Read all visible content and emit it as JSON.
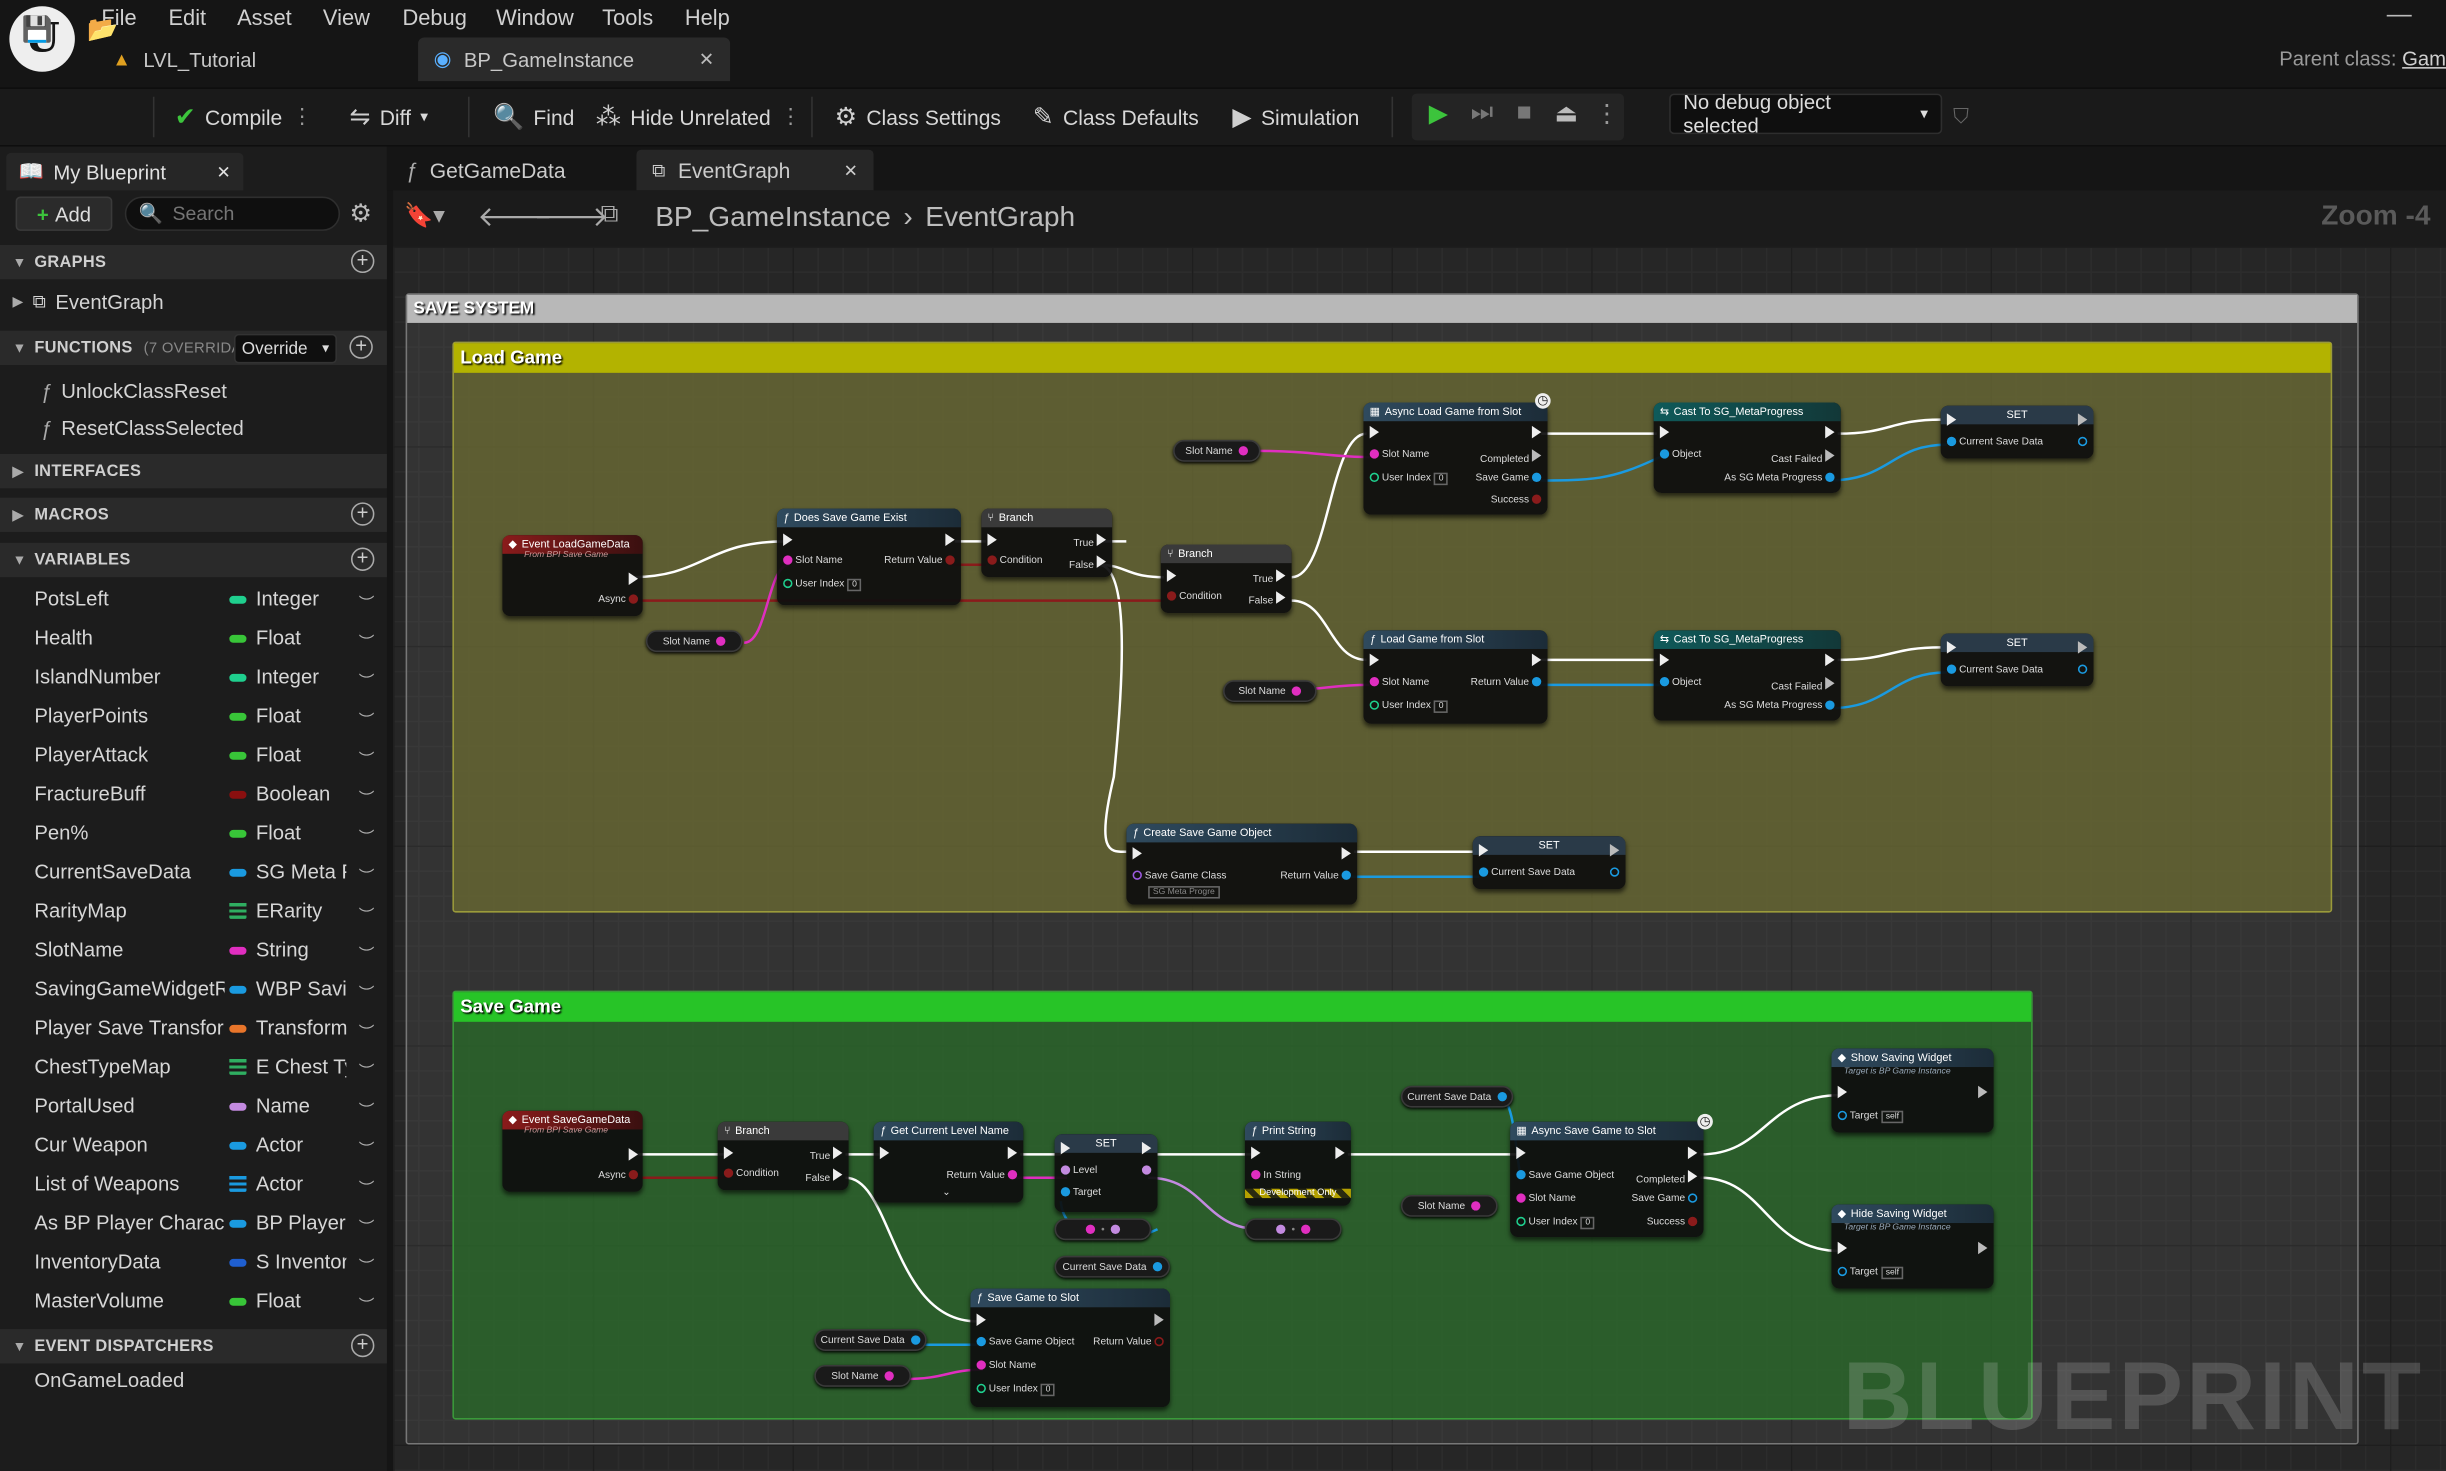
{
  "menu": [
    "File",
    "Edit",
    "Asset",
    "View",
    "Debug",
    "Window",
    "Tools",
    "Help"
  ],
  "window_tabs": [
    {
      "label": "LVL_Tutorial"
    },
    {
      "label": "BP_GameInstance"
    }
  ],
  "parent_class": {
    "label": "Parent class:",
    "value": "Gam"
  },
  "toolbar": {
    "compile": "Compile",
    "diff": "Diff",
    "find": "Find",
    "hide_unrelated": "Hide Unrelated",
    "class_settings": "Class Settings",
    "class_defaults": "Class Defaults",
    "simulation": "Simulation",
    "debug_object": "No debug object selected"
  },
  "colors": {
    "accent_green": "#3ba93b",
    "load_game": "#b3b300",
    "save_game": "#27c427",
    "event_red": "#8a1b1b",
    "func_blue": "#2f4a5e",
    "cast_teal": "#0f5a5a"
  },
  "panel": {
    "tab": "My Blueprint",
    "add": "Add",
    "search_placeholder": "Search",
    "sections": {
      "graphs": "GRAPHS",
      "functions": "FUNCTIONS",
      "functions_count": "(7 OVERRIDAB",
      "override": "Override",
      "interfaces": "INTERFACES",
      "macros": "MACROS",
      "variables": "VARIABLES",
      "dispatchers": "EVENT DISPATCHERS"
    },
    "graphs": [
      "EventGraph"
    ],
    "functions": [
      "UnlockClassReset",
      "ResetClassSelected"
    ],
    "variables": [
      {
        "name": "PotsLeft",
        "type": "Integer",
        "color": "#1fcf8e"
      },
      {
        "name": "Health",
        "type": "Float",
        "color": "#38c538"
      },
      {
        "name": "IslandNumber",
        "type": "Integer",
        "color": "#1fcf8e"
      },
      {
        "name": "PlayerPoints",
        "type": "Float",
        "color": "#38c538"
      },
      {
        "name": "PlayerAttack",
        "type": "Float",
        "color": "#38c538"
      },
      {
        "name": "FractureBuff",
        "type": "Boolean",
        "color": "#8a0f0f"
      },
      {
        "name": "Pen%",
        "type": "Float",
        "color": "#38c538"
      },
      {
        "name": "CurrentSaveData",
        "type": "SG Meta F",
        "color": "#1a9ae0"
      },
      {
        "name": "RarityMap",
        "type": "ERarity",
        "color": "#2fae61",
        "map": true
      },
      {
        "name": "SlotName",
        "type": "String",
        "color": "#e02ec0"
      },
      {
        "name": "SavingGameWidgetR",
        "type": "WBP Savi",
        "color": "#1a9ae0"
      },
      {
        "name": "Player Save Transfor",
        "type": "Transform",
        "color": "#e8752a"
      },
      {
        "name": "ChestTypeMap",
        "type": "E Chest Ty",
        "color": "#2fae61",
        "map": true
      },
      {
        "name": "PortalUsed",
        "type": "Name",
        "color": "#c38ae0"
      },
      {
        "name": "Cur Weapon",
        "type": "Actor",
        "color": "#1a9ae0"
      },
      {
        "name": "List of Weapons",
        "type": "Actor",
        "color": "#1a9ae0",
        "map": true
      },
      {
        "name": "As BP Player Charac",
        "type": "BP Player",
        "color": "#1a9ae0"
      },
      {
        "name": "InventoryData",
        "type": "S Inventor",
        "color": "#1f5fd0"
      },
      {
        "name": "MasterVolume",
        "type": "Float",
        "color": "#38c538"
      }
    ],
    "dispatchers": [
      "OnGameLoaded"
    ]
  },
  "doc_tabs": [
    "GetGameData",
    "EventGraph"
  ],
  "breadcrumb": [
    "BP_GameInstance",
    "EventGraph"
  ],
  "zoom": "Zoom -4",
  "graph": {
    "outer_comment": "SAVE SYSTEM",
    "load_comment": "Load Game",
    "save_comment": "Save Game",
    "watermark": "BLUEPRINT",
    "nodes": {
      "event_load": {
        "title": "Event LoadGameData",
        "sub": "From BPI Save Game",
        "pin": "Async"
      },
      "does_exist": {
        "title": "Does Save Game Exist",
        "p1": "Slot Name",
        "p2": "User Index",
        "rv": "Return Value",
        "v": "0"
      },
      "branch1": {
        "title": "Branch",
        "cond": "Condition",
        "t": "True",
        "f": "False"
      },
      "branch2": {
        "title": "Branch",
        "cond": "Condition",
        "t": "True",
        "f": "False"
      },
      "async_load": {
        "title": "Async Load Game from Slot",
        "p1": "Slot Name",
        "p2": "User Index",
        "o1": "Completed",
        "o2": "Save Game",
        "o3": "Success",
        "v": "0"
      },
      "cast1": {
        "title": "Cast To SG_MetaProgress",
        "p": "Object",
        "o1": "Cast Failed",
        "o2": "As SG Meta Progress"
      },
      "set1": {
        "title": "SET",
        "p": "Current Save Data"
      },
      "load_slot": {
        "title": "Load Game from Slot",
        "p1": "Slot Name",
        "p2": "User Index",
        "rv": "Return Value",
        "v": "0"
      },
      "cast2": {
        "title": "Cast To SG_MetaProgress",
        "p": "Object",
        "o1": "Cast Failed",
        "o2": "As SG Meta Progress"
      },
      "set2": {
        "title": "SET",
        "p": "Current Save Data"
      },
      "create_save": {
        "title": "Create Save Game Object",
        "p": "Save Game Class",
        "cls": "SG Meta Progre",
        "rv": "Return Value"
      },
      "set3": {
        "title": "SET",
        "p": "Current Save Data"
      },
      "event_save": {
        "title": "Event SaveGameData",
        "sub": "From BPI Save Game",
        "pin": "Async"
      },
      "branch3": {
        "title": "Branch",
        "cond": "Condition",
        "t": "True",
        "f": "False"
      },
      "get_level": {
        "title": "Get Current Level Name",
        "rv": "Return Value"
      },
      "set_level": {
        "title": "SET",
        "p1": "Level",
        "p2": "Target"
      },
      "print": {
        "title": "Print String",
        "p": "In String",
        "dev": "Development Only"
      },
      "async_save": {
        "title": "Async Save Game to Slot",
        "p1": "Save Game Object",
        "p2": "Slot Name",
        "p3": "User Index",
        "o1": "Completed",
        "o2": "Save Game",
        "o3": "Success",
        "v": "0"
      },
      "show_widget": {
        "title": "Show Saving Widget",
        "sub": "Target is BP Game Instance",
        "p": "Target",
        "v": "self"
      },
      "hide_widget": {
        "title": "Hide Saving Widget",
        "sub": "Target is BP Game Instance",
        "p": "Target",
        "v": "self"
      },
      "save_slot": {
        "title": "Save Game to Slot",
        "p1": "Save Game Object",
        "p2": "Slot Name",
        "p3": "User Index",
        "rv": "Return Value",
        "v": "0"
      }
    },
    "vars": {
      "slot_name": "Slot Name",
      "current_save_data": "Current Save Data"
    }
  }
}
